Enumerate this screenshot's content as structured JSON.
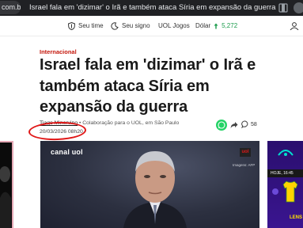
{
  "browser": {
    "url_fragment": "com.br",
    "tab_title": "Israel fala em 'dizimar' o Irã e também ataca Síria em expansão da guerra"
  },
  "header": {
    "seu_time": "Seu time",
    "seu_signo": "Seu signo",
    "uol_jogos": "UOL Jogos",
    "dolar_label": "Dólar",
    "dolar_value": "5,272"
  },
  "article": {
    "section": "Internacional",
    "headline": "Israel fala em 'dizimar' o Irã e também ataca Síria em expansão da guerra",
    "author": "Tiago Minervino",
    "byline_rest": " • Colaboração para o UOL, em São Paulo",
    "date": "20/03/2026 08h20",
    "comment_count": "58"
  },
  "video": {
    "channel": "canal",
    "channel_brand": "uol",
    "badge": "uol",
    "credit": "Imagens: AFP"
  },
  "right_ad": {
    "bar_text": "HOJE, 16:45",
    "footer_text": "LENS"
  },
  "colors": {
    "accent": "#c4170c",
    "highlight_circle": "#e01818",
    "whatsapp": "#25d366",
    "dolar_up": "#1a9b4b"
  }
}
